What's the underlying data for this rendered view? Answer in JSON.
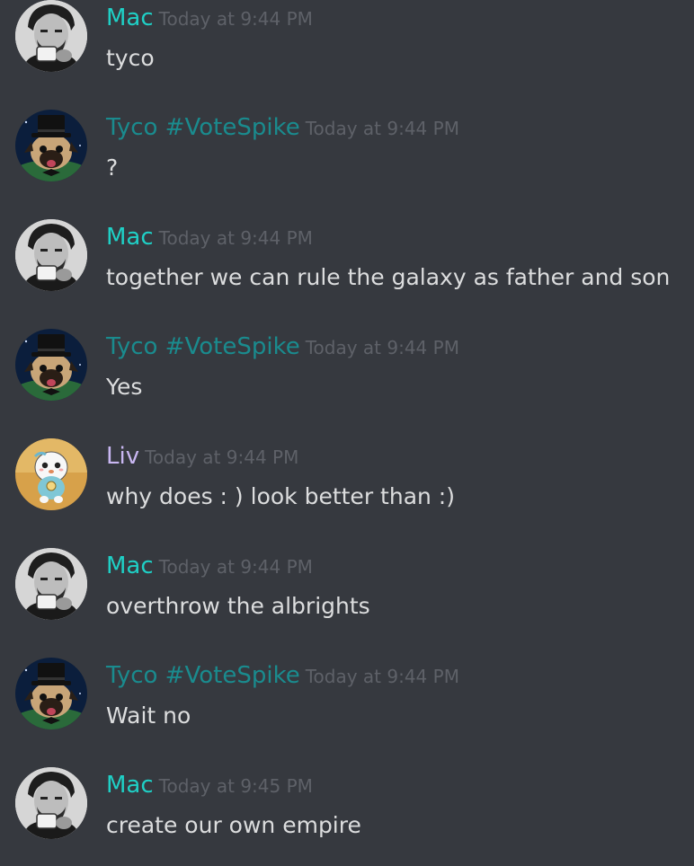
{
  "colors": {
    "background": "#36393f",
    "mac": "#1fd0c6",
    "tyco": "#1a8b8e",
    "liv": "#c9b7f2",
    "timestamp": "#5e6168",
    "text": "#dcddde"
  },
  "messages": [
    {
      "author": "Mac",
      "avatar": "mac-avatar",
      "time": "Today at 9:44 PM",
      "text": "tyco"
    },
    {
      "author": "Tyco #VoteSpike",
      "avatar": "pug-avatar",
      "time": "Today at 9:44 PM",
      "text": "?"
    },
    {
      "author": "Mac",
      "avatar": "mac-avatar",
      "time": "Today at 9:44 PM",
      "text": "together we can rule the galaxy as father and son"
    },
    {
      "author": "Tyco #VoteSpike",
      "avatar": "pug-avatar",
      "time": "Today at 9:44 PM",
      "text": "Yes"
    },
    {
      "author": "Liv",
      "avatar": "oshawott-avatar",
      "time": "Today at 9:44 PM",
      "text": "why does : ) look better than :)"
    },
    {
      "author": "Mac",
      "avatar": "mac-avatar",
      "time": "Today at 9:44 PM",
      "text": "overthrow the albrights"
    },
    {
      "author": "Tyco #VoteSpike",
      "avatar": "pug-avatar",
      "time": "Today at 9:44 PM",
      "text": "Wait no"
    },
    {
      "author": "Mac",
      "avatar": "mac-avatar",
      "time": "Today at 9:45 PM",
      "text": "create our own empire"
    }
  ]
}
